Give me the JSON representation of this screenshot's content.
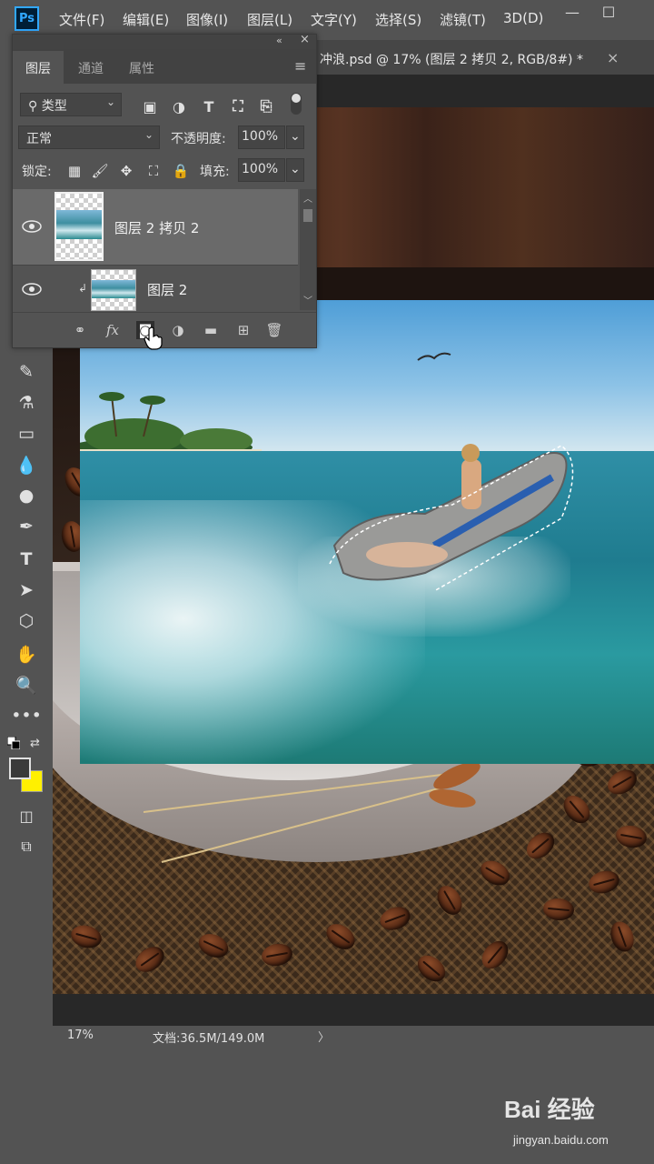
{
  "app": {
    "logo": "Ps"
  },
  "menubar": {
    "items": [
      "文件(F)",
      "编辑(E)",
      "图像(I)",
      "图层(L)",
      "文字(Y)",
      "选择(S)",
      "滤镜(T)",
      "3D(D)"
    ]
  },
  "window": {
    "minimize": "—",
    "restore": "☐"
  },
  "document_tab": {
    "title": "冲浪.psd @ 17% (图层 2 拷贝 2, RGB/8#) *",
    "close": "×"
  },
  "layers_panel": {
    "collapse": "«",
    "close": "×",
    "tabs": [
      "图层",
      "通道",
      "属性"
    ],
    "filter": {
      "label": "类型"
    },
    "blend_mode": "正常",
    "opacity_label": "不透明度:",
    "opacity_value": "100%",
    "lock_label": "锁定:",
    "fill_label": "填充:",
    "fill_value": "100%",
    "layers": [
      {
        "name": "图层 2 拷贝 2",
        "visible": true,
        "selected": true
      },
      {
        "name": "图层 2",
        "visible": true,
        "clipped": true
      }
    ],
    "footer": {
      "fx": "fx"
    }
  },
  "statusbar": {
    "zoom": "17%",
    "doc_size": "文档:36.5M/149.0M",
    "arrow": "〉"
  },
  "colors": {
    "foreground": "#3a3a3a",
    "background": "#fff000",
    "accent": "#31a8ff"
  },
  "watermark": {
    "logo": "Bai 经验",
    "url": "jingyan.baidu.com"
  }
}
